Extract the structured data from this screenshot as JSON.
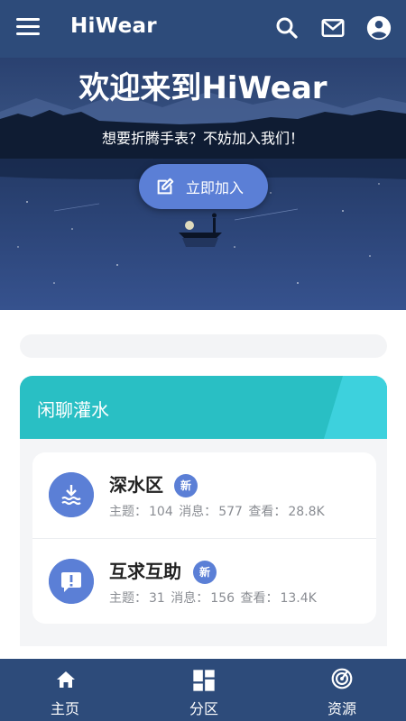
{
  "appbar": {
    "title": "HiWear",
    "icons": [
      "menu-icon",
      "search-icon",
      "mail-icon",
      "account-icon"
    ]
  },
  "hero": {
    "title": "欢迎来到HiWear",
    "subtitle": "想要折腾手表？不妨加入我们！",
    "join_label": "立即加入",
    "join_icon": "edit-icon"
  },
  "forum": {
    "category_title": "闲聊灌水",
    "boards": [
      {
        "name": "深水区",
        "badge": "新",
        "icon": "water-download-icon",
        "topics_label": "主题：",
        "topics": "104",
        "messages_label": "消息：",
        "messages": "577",
        "views_label": "查看：",
        "views": "28.8K"
      },
      {
        "name": "互求互助",
        "badge": "新",
        "icon": "alert-bubble-icon",
        "topics_label": "主题：",
        "topics": "31",
        "messages_label": "消息：",
        "messages": "156",
        "views_label": "查看：",
        "views": "13.4K"
      }
    ]
  },
  "bottom_nav": {
    "items": [
      {
        "label": "主页",
        "icon": "home-icon"
      },
      {
        "label": "分区",
        "icon": "dashboard-icon"
      },
      {
        "label": "资源",
        "icon": "radar-icon"
      }
    ]
  },
  "colors": {
    "primary": "#2d4b7a",
    "accent": "#5b7fd6",
    "teal": "#29bfc4"
  }
}
